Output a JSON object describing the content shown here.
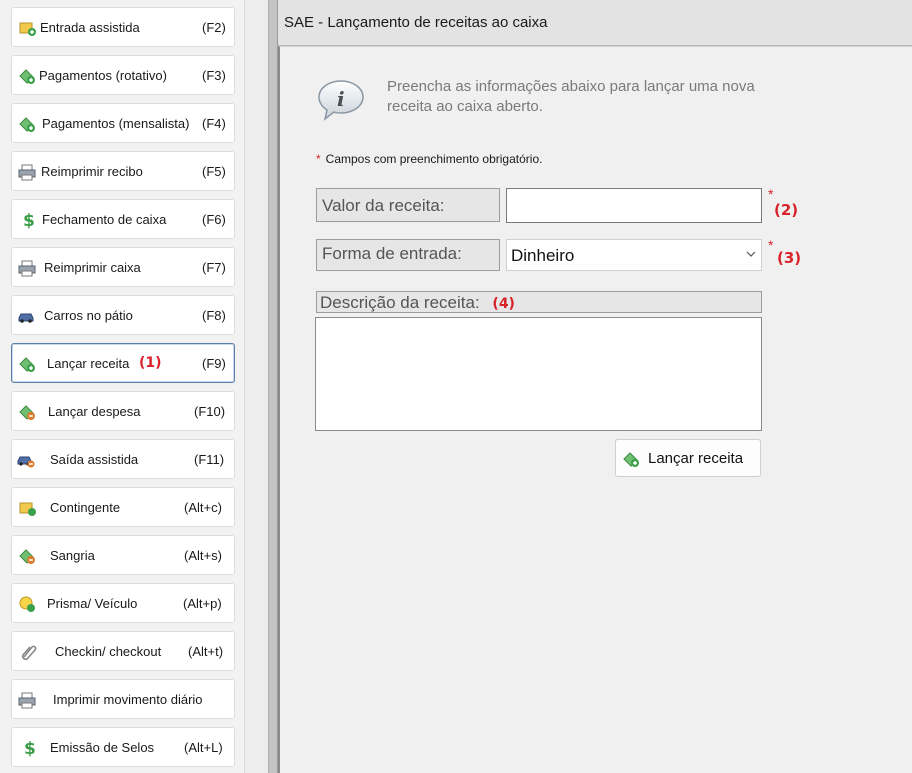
{
  "sidebar": {
    "items": [
      {
        "label": "Entrada assistida",
        "shortcut": "(F2)",
        "icon": "entry-icon"
      },
      {
        "label": "Pagamentos (rotativo)",
        "shortcut": "(F3)",
        "icon": "money-add-icon"
      },
      {
        "label": "Pagamentos (mensalista)",
        "shortcut": "(F4)",
        "icon": "money-add-icon"
      },
      {
        "label": "Reimprimir recibo",
        "shortcut": "(F5)",
        "icon": "printer-icon"
      },
      {
        "label": "Fechamento de caixa",
        "shortcut": "(F6)",
        "icon": "dollar-icon"
      },
      {
        "label": "Reimprimir caixa",
        "shortcut": "(F7)",
        "icon": "printer-icon"
      },
      {
        "label": "Carros no pátio",
        "shortcut": "(F8)",
        "icon": "car-icon"
      },
      {
        "label": "Lançar receita",
        "marker": "(1)",
        "shortcut": "(F9)",
        "icon": "money-add-icon",
        "active": true
      },
      {
        "label": "Lançar despesa",
        "shortcut": "(F10)",
        "icon": "money-remove-icon"
      },
      {
        "label": "Saída assistida",
        "shortcut": "(F11)",
        "icon": "car-exit-icon"
      },
      {
        "label": "Contingente",
        "shortcut": "(Alt+c)",
        "icon": "contingent-icon"
      },
      {
        "label": "Sangria",
        "shortcut": "(Alt+s)",
        "icon": "money-remove-icon"
      },
      {
        "label": "Prisma/ Veículo",
        "shortcut": "(Alt+p)",
        "icon": "prism-icon"
      },
      {
        "label": "Checkin/ checkout",
        "shortcut": "(Alt+t)",
        "icon": "paperclip-icon"
      },
      {
        "label": "Imprimir movimento diário",
        "shortcut": "",
        "icon": "printer-icon"
      },
      {
        "label": "Emissão de Selos",
        "shortcut": "(Alt+L)",
        "icon": "dollar-icon"
      }
    ]
  },
  "main": {
    "title": "SAE - Lançamento de receitas ao caixa",
    "info_text": "Preencha as informações abaixo para lançar uma nova receita ao caixa aberto.",
    "required_star": "*",
    "required_note": "Campos com preenchimento obrigatório.",
    "valor": {
      "label": "Valor da receita:",
      "value": "",
      "star": "*",
      "marker": "(2)"
    },
    "forma": {
      "label": "Forma de entrada:",
      "selected": "Dinheiro",
      "star": "*",
      "marker": "(3)"
    },
    "descricao": {
      "label": "Descrição da receita:",
      "marker": "(4)",
      "value": ""
    },
    "submit_label": "Lançar receita"
  },
  "colors": {
    "accent_red": "#d8232a",
    "active_border": "#5b7fa8"
  }
}
